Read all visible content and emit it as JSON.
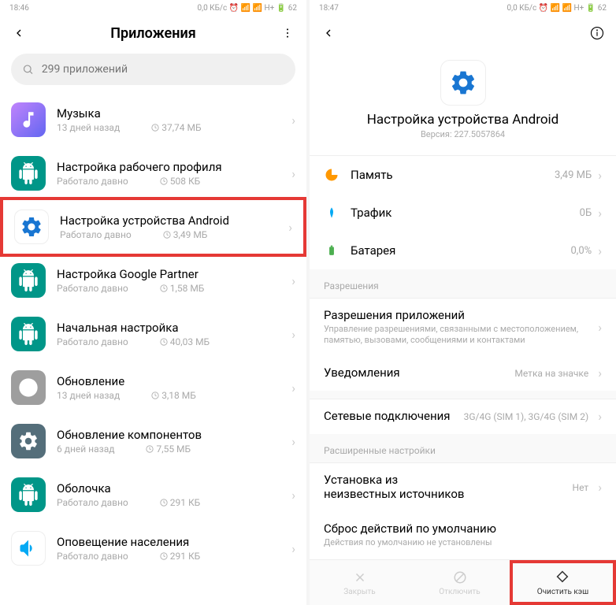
{
  "left": {
    "status_time": "18:46",
    "status_right": "0,0 КБ/с ⏰ 📶 📶 H+ 🔋 62",
    "title": "Приложения",
    "search_placeholder": "299 приложений",
    "apps": [
      {
        "name": "Музыка",
        "time": "13 дней назад",
        "size": "37,74 МБ",
        "icon": "music"
      },
      {
        "name": "Настройка рабочего профиля",
        "time": "Работало давно",
        "size": "508 КБ",
        "icon": "android"
      },
      {
        "name": "Настройка устройства Android",
        "time": "Работало давно",
        "size": "3,49 МБ",
        "icon": "gear",
        "highlighted": true
      },
      {
        "name": "Настройка Google Partner",
        "time": "Работало давно",
        "size": "1,58 МБ",
        "icon": "android"
      },
      {
        "name": "Начальная настройка",
        "time": "Работало давно",
        "size": "40,03 МБ",
        "icon": "android"
      },
      {
        "name": "Обновление",
        "time": "13 дней назад",
        "size": "3,18 МБ",
        "icon": "grey"
      },
      {
        "name": "Обновление компонентов",
        "time": "6 дней назад",
        "size": "7,55 МБ",
        "icon": "gear-dark"
      },
      {
        "name": "Оболочка",
        "time": "Работало давно",
        "size": "291 КБ",
        "icon": "android"
      },
      {
        "name": "Оповещение населения",
        "time": "Работало давно",
        "size": "291 КБ",
        "icon": "horn"
      }
    ]
  },
  "right": {
    "status_time": "18:47",
    "status_right": "0,0 КБ/с ⏰ 📶 📶 H+ 🔋 62",
    "app_title": "Настройка устройства Android",
    "app_version": "Версия: 227.5057864",
    "stats": {
      "memory_label": "Память",
      "memory_value": "3,49 МБ",
      "traffic_label": "Трафик",
      "traffic_value": "0Б",
      "battery_label": "Батарея",
      "battery_value": "0,0%"
    },
    "permissions_section": "Разрешения",
    "perms": {
      "title": "Разрешения приложений",
      "sub": "Управление разрешениями, связанными с местоположением, памятью, вызовами, сообщениями и контактами"
    },
    "notifications": {
      "title": "Уведомления",
      "value": "Метка на значке"
    },
    "network": {
      "title": "Сетевые подключения",
      "value": "3G/4G (SIM 1), 3G/4G (SIM 2)"
    },
    "advanced_section": "Расширенные настройки",
    "unknown": {
      "title": "Установка из неизвестных источников",
      "value": "Нет"
    },
    "reset": {
      "title": "Сброс действий по умолчанию",
      "sub": "Действия по умолчанию не установлены"
    },
    "bottom": {
      "close": "Закрыть",
      "disable": "Отключить",
      "clear_cache": "Очистить кэш"
    }
  }
}
